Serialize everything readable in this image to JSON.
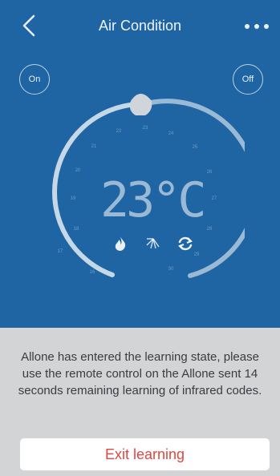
{
  "header": {
    "title": "Air Condition"
  },
  "power": {
    "on_label": "On",
    "off_label": "Off"
  },
  "dial": {
    "temperature": "23°C",
    "set_point": 23,
    "scale_min": 16,
    "scale_max": 30,
    "ticks": [
      "16",
      "17",
      "18",
      "19",
      "20",
      "21",
      "22",
      "23",
      "24",
      "25",
      "26",
      "27",
      "28",
      "29",
      "30"
    ]
  },
  "modes": {
    "icons": [
      "flame-icon",
      "swing-icon",
      "cycle-icon"
    ]
  },
  "learning": {
    "message": "Allone has entered the learning state, please use the remote control on the Allone sent 14 seconds remaining learning of infrared codes.",
    "exit_label": "Exit learning"
  },
  "colors": {
    "background": "#1f65a3",
    "sheet": "#d2d4d6",
    "exit_text": "#e2463f"
  }
}
